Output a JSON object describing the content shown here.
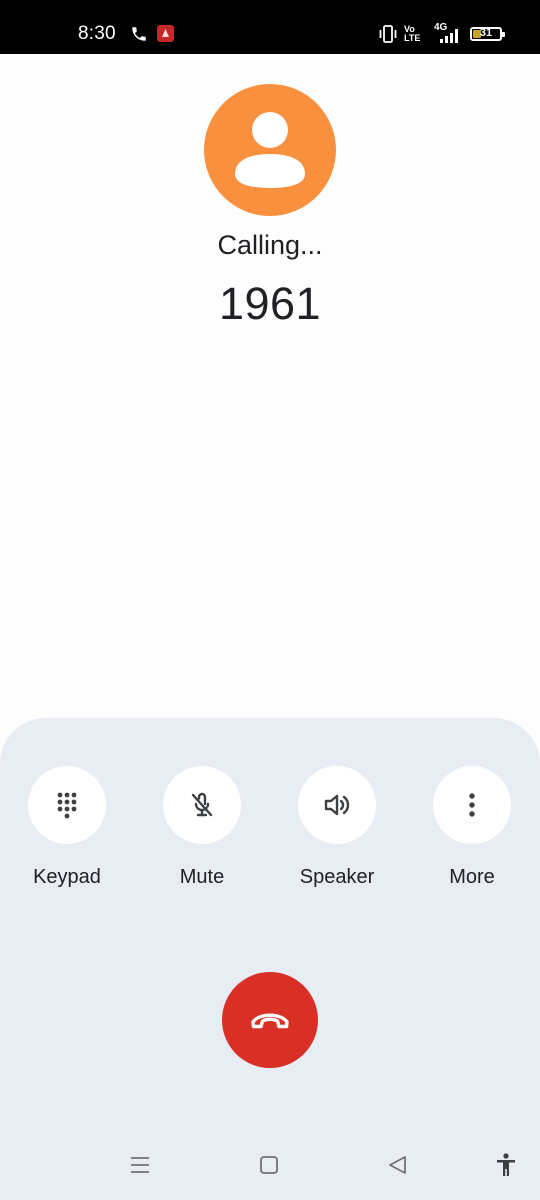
{
  "status_bar": {
    "time": "8:30",
    "volte_line1": "Vo",
    "volte_line2": "LTE",
    "network": "4G",
    "battery": "31",
    "battery_level": 0.31
  },
  "caller": {
    "status": "Calling...",
    "number": "1961",
    "avatar_color": "#f9903e"
  },
  "controls": [
    {
      "label": "Keypad",
      "icon": "dialpad-icon"
    },
    {
      "label": "Mute",
      "icon": "mic-off-icon"
    },
    {
      "label": "Speaker",
      "icon": "speaker-icon"
    },
    {
      "label": "More",
      "icon": "more-vert-icon"
    }
  ],
  "end_call": {
    "icon": "call-end-icon",
    "color": "#d93025"
  },
  "nav": [
    "menu-icon",
    "home-icon",
    "back-icon",
    "accessibility-icon"
  ]
}
